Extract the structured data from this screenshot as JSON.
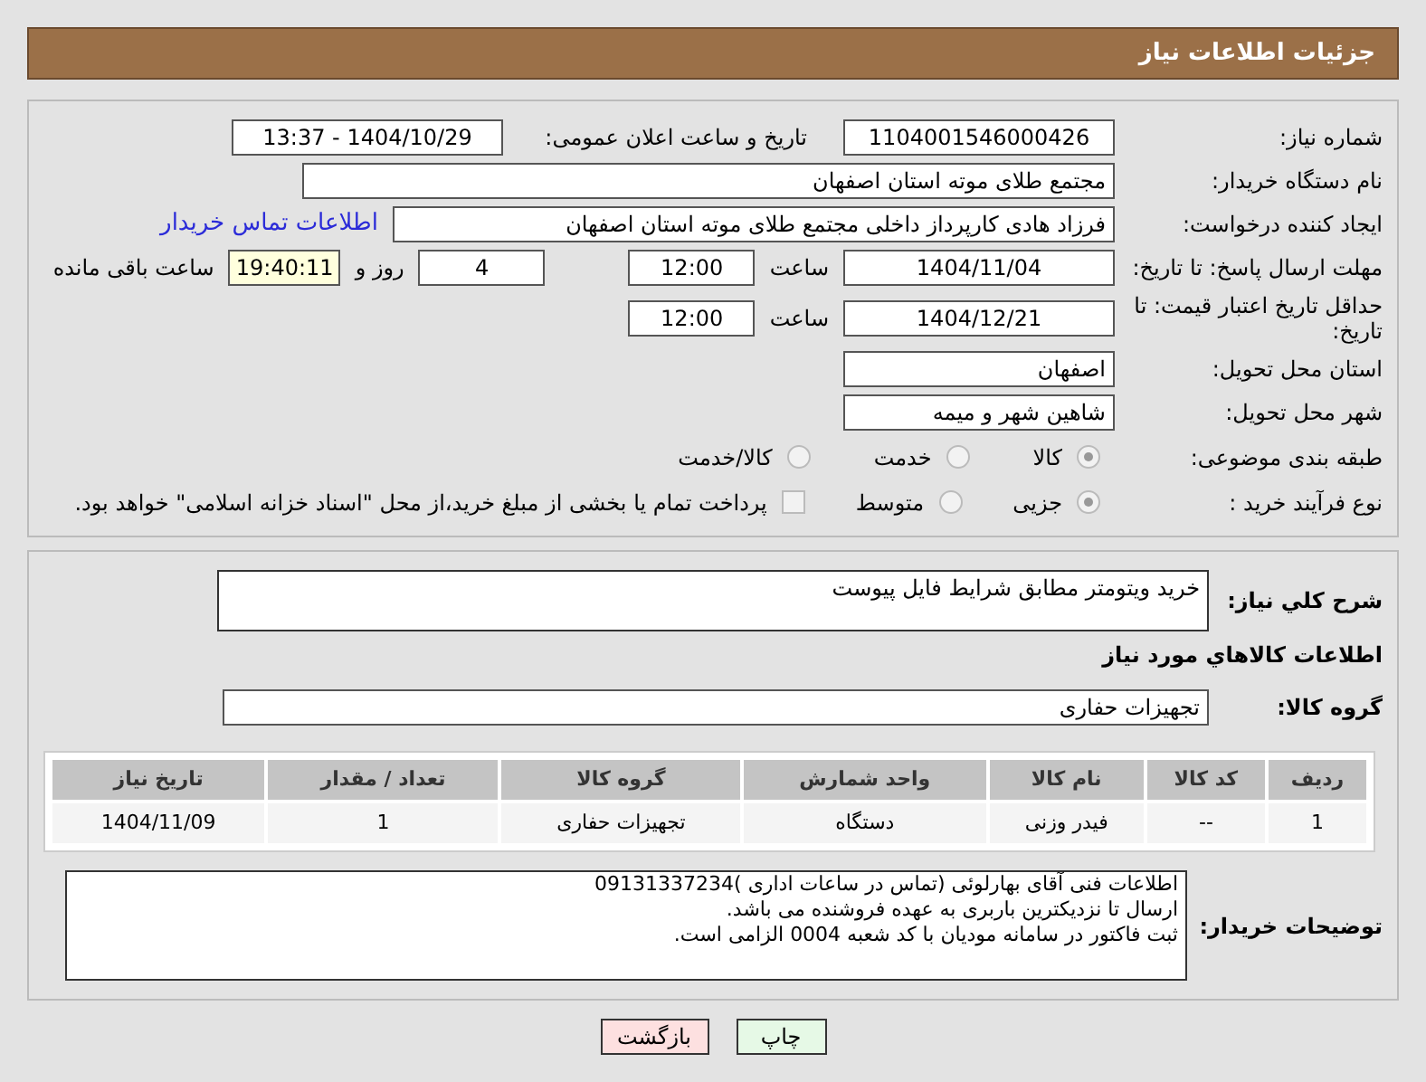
{
  "header": {
    "title": "جزئیات اطلاعات نیاز"
  },
  "need_number": {
    "label": "شماره نیاز:",
    "value": "1104001546000426"
  },
  "announce": {
    "label": "تاریخ و ساعت اعلان عمومی:",
    "value": "1404/10/29 - 13:37"
  },
  "buyer_org": {
    "label": "نام دستگاه خریدار:",
    "value": "مجتمع طلای موته استان اصفهان"
  },
  "requester": {
    "label": "ایجاد کننده درخواست:",
    "value": "فرزاد هادی کارپرداز داخلی مجتمع طلای موته استان اصفهان",
    "link": "اطلاعات تماس خریدار"
  },
  "deadline": {
    "label": "مهلت ارسال پاسخ: تا تاریخ:",
    "date": "1404/11/04",
    "time_label": "ساعت",
    "time": "12:00",
    "days": "4",
    "days_label": "روز و",
    "remaining": "19:40:11",
    "remaining_label": "ساعت باقی مانده"
  },
  "validity": {
    "label": "حداقل تاریخ اعتبار قیمت: تا تاریخ:",
    "date": "1404/12/21",
    "time_label": "ساعت",
    "time": "12:00"
  },
  "province": {
    "label": "استان محل تحویل:",
    "value": "اصفهان"
  },
  "city": {
    "label": "شهر محل تحویل:",
    "value": "شاهین شهر و میمه"
  },
  "category": {
    "label": "طبقه بندی موضوعی:",
    "options": [
      {
        "label": "کالا",
        "selected": true
      },
      {
        "label": "خدمت",
        "selected": false
      },
      {
        "label": "کالا/خدمت",
        "selected": false
      }
    ]
  },
  "process": {
    "label": "نوع فرآیند خرید :",
    "options": [
      {
        "label": "جزیی",
        "selected": true
      },
      {
        "label": "متوسط",
        "selected": false
      }
    ],
    "payment": {
      "checked": false,
      "label": "پرداخت تمام یا بخشی از مبلغ خرید،از محل \"اسناد خزانه اسلامی\" خواهد بود."
    }
  },
  "description": {
    "label": "شرح کلي نياز:",
    "value": "خرید ویتومتر مطابق شرایط فایل پیوست"
  },
  "goods_heading": "اطلاعات کالاهاي مورد نياز",
  "goods_group": {
    "label": "گروه کالا:",
    "value": "تجهیزات حفاری"
  },
  "table": {
    "columns": [
      "ردیف",
      "کد کالا",
      "نام کالا",
      "واحد شمارش",
      "گروه کالا",
      "تعداد / مقدار",
      "تاریخ نیاز"
    ],
    "rows": [
      [
        "1",
        "--",
        "فیدر وزنی",
        "دستگاه",
        "تجهیزات حفاری",
        "1",
        "1404/11/09"
      ]
    ]
  },
  "buyer_notes": {
    "label": "توضیحات خریدار:",
    "lines": [
      "اطلاعات فنی آقای بهارلوئی (تماس در ساعات اداری )09131337234",
      "ارسال تا نزدیکترین باربری به عهده فروشنده می باشد.",
      "ثبت فاکتور در سامانه مودیان با کد شعبه 0004 الزامی است."
    ]
  },
  "buttons": [
    {
      "kind": "print",
      "label": "چاپ"
    },
    {
      "kind": "back",
      "label": "بازگشت"
    }
  ]
}
